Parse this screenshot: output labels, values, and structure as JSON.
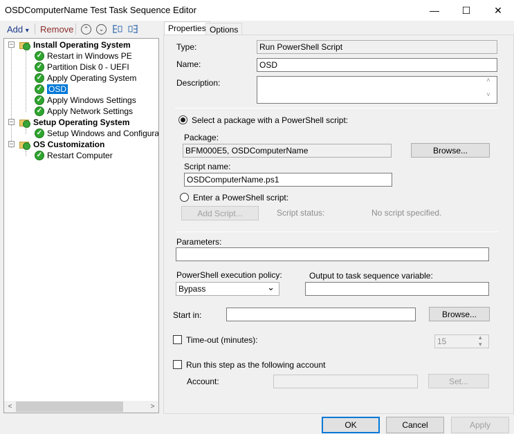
{
  "window": {
    "title": "OSDComputerName Test Task Sequence Editor",
    "minimize_glyph": "—",
    "maximize_glyph": "☐",
    "close_glyph": "✕"
  },
  "toolbar": {
    "add_label": "Add",
    "add_arrow": "▾",
    "remove_label": "Remove",
    "icons": [
      "move-up-icon",
      "move-down-icon",
      "indent-icon",
      "outdent-icon"
    ]
  },
  "tree": {
    "groups": [
      {
        "label": "Install Operating System",
        "expander": "−",
        "steps": [
          "Restart in Windows PE",
          "Partition Disk 0 - UEFI",
          "Apply Operating System",
          "OSD",
          "Apply Windows Settings",
          "Apply Network Settings"
        ]
      },
      {
        "label": "Setup Operating System",
        "expander": "−",
        "steps": [
          "Setup Windows and Configuration"
        ]
      },
      {
        "label": "OS Customization",
        "expander": "−",
        "steps": [
          "Restart Computer"
        ]
      }
    ],
    "selected_step": "OSD",
    "scroll_left": "<",
    "scroll_right": ">"
  },
  "tabs": [
    {
      "label": "Properties",
      "active": true
    },
    {
      "label": "Options",
      "active": false
    }
  ],
  "properties": {
    "type_label": "Type:",
    "type_value": "Run PowerShell Script",
    "name_label": "Name:",
    "name_value": "OSD",
    "description_label": "Description:",
    "description_value": "",
    "description_scroll_up": "˄",
    "description_scroll_down": "˅",
    "radio_package_label": "Select a package with a PowerShell script:",
    "radio_package_selected": true,
    "package_label": "Package:",
    "package_value": "BFM000E5, OSDComputerName",
    "browse_label": "Browse...",
    "script_name_label": "Script name:",
    "script_name_value": "OSDComputerName.ps1",
    "radio_enter_label": "Enter a PowerShell script:",
    "add_script_label": "Add Script...",
    "script_status_label": "Script status:",
    "script_status_value": "No script specified.",
    "parameters_label": "Parameters:",
    "parameters_value": "",
    "policy_label": "PowerShell execution policy:",
    "policy_value": "Bypass",
    "policy_arrow": "⌄",
    "output_label": "Output to task sequence variable:",
    "output_value": "",
    "start_in_label": "Start in:",
    "start_in_value": "",
    "timeout_label": "Time-out (minutes):",
    "timeout_value": "15",
    "timeout_checked": false,
    "spinner_up": "▴",
    "spinner_down": "▾",
    "run_as_label": "Run this step as the following account",
    "run_as_checked": false,
    "account_label": "Account:",
    "account_value": "",
    "set_label": "Set..."
  },
  "footer": {
    "ok_label": "OK",
    "cancel_label": "Cancel",
    "apply_label": "Apply"
  },
  "colors": {
    "selection": "#0078d7",
    "step_check": "#2fa52f",
    "window_bg": "#f0f0f0"
  }
}
